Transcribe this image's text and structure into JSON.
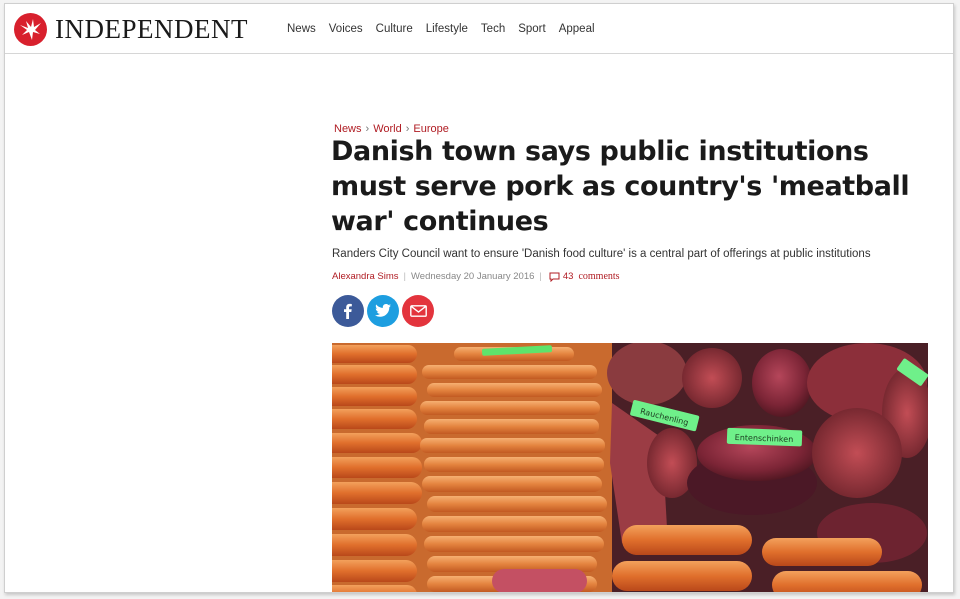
{
  "header": {
    "wordmark": "INDEPENDENT",
    "nav": [
      "News",
      "Voices",
      "Culture",
      "Lifestyle",
      "Tech",
      "Sport",
      "Appeal"
    ]
  },
  "article": {
    "breadcrumb": [
      "News",
      "World",
      "Europe"
    ],
    "headline": "Danish town says public institutions must serve pork as country's 'meatball war' continues",
    "standfirst": "Randers City Council want to ensure 'Danish food culture' is a central part of offerings at public institutions",
    "author": "Alexandra Sims",
    "date": "Wednesday 20 January 2016",
    "comment_count": "43",
    "comment_label": "comments",
    "photo_tags": [
      "Rauchenling",
      "Entenschinken"
    ]
  },
  "colors": {
    "brand_red": "#b01c23",
    "facebook": "#3c5a99",
    "twitter": "#1d9ee0",
    "email": "#e3343d"
  },
  "icons": [
    "eagle-logo-icon",
    "facebook-icon",
    "twitter-icon",
    "email-icon",
    "comment-icon"
  ]
}
